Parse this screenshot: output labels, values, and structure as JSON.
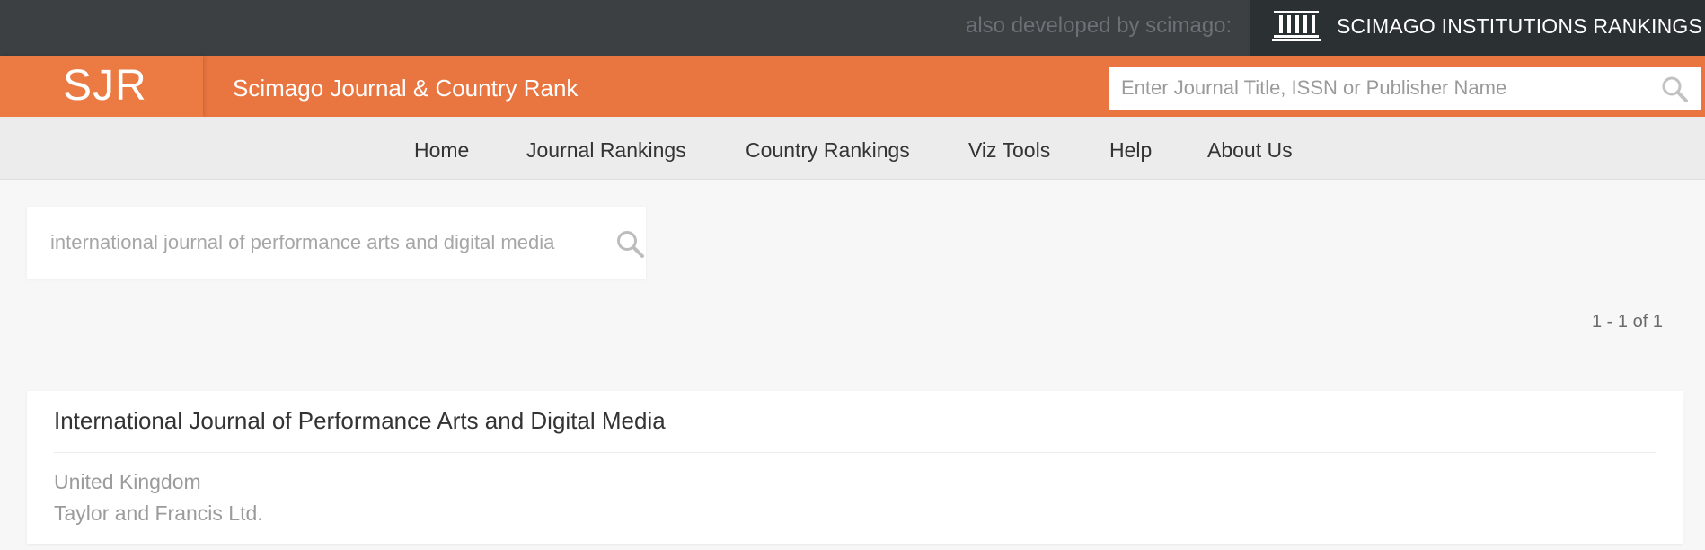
{
  "topbar": {
    "also_developed": "also developed by scimago:",
    "sir_label": "SCIMAGO INSTITUTIONS RANKINGS"
  },
  "header": {
    "logo": "SJR",
    "title": "Scimago Journal & Country Rank",
    "search_placeholder": "Enter Journal Title, ISSN or Publisher Name"
  },
  "nav": {
    "items": [
      {
        "label": "Home"
      },
      {
        "label": "Journal Rankings"
      },
      {
        "label": "Country Rankings"
      },
      {
        "label": "Viz Tools"
      },
      {
        "label": "Help"
      },
      {
        "label": "About Us"
      }
    ]
  },
  "search": {
    "value": "international journal of performance arts and digital media"
  },
  "results": {
    "count_text": "1 - 1 of 1",
    "items": [
      {
        "title": "International Journal of Performance Arts and Digital Media",
        "country": "United Kingdom",
        "publisher": "Taylor and Francis Ltd."
      }
    ]
  },
  "colors": {
    "brand_orange": "#e97640",
    "topbar_dark": "#3c4043",
    "sir_dark": "#2b3033"
  }
}
